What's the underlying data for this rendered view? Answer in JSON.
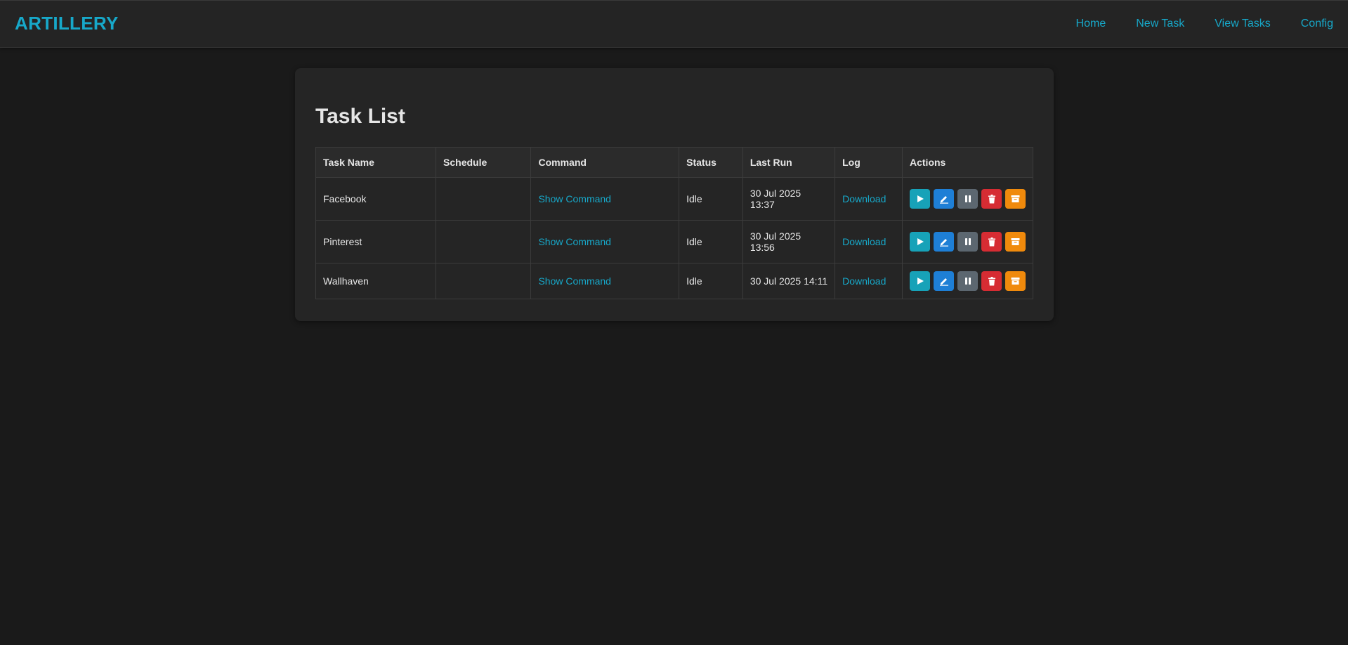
{
  "brand": "ARTILLERY",
  "nav": {
    "home": "Home",
    "new_task": "New Task",
    "view_tasks": "View Tasks",
    "config": "Config"
  },
  "page": {
    "title": "Task List"
  },
  "table": {
    "headers": [
      "Task Name",
      "Schedule",
      "Command",
      "Status",
      "Last Run",
      "Log",
      "Actions"
    ],
    "rows": [
      {
        "name": "Facebook",
        "schedule": "",
        "command": "Show Command",
        "status": "Idle",
        "last_run_date": "30 Jul 2025",
        "last_run_time": "13:37",
        "log": "Download"
      },
      {
        "name": "Pinterest",
        "schedule": "",
        "command": "Show Command",
        "status": "Idle",
        "last_run_date": "30 Jul 2025",
        "last_run_time": "13:56",
        "log": "Download"
      },
      {
        "name": "Wallhaven",
        "schedule": "",
        "command": "Show Command",
        "status": "Idle",
        "last_run_date": "30 Jul 2025",
        "last_run_time": "14:11",
        "log": "Download"
      }
    ]
  },
  "action_icons": [
    "play-icon",
    "edit-icon",
    "pause-icon",
    "trash-icon",
    "archive-icon"
  ],
  "colors": {
    "accent": "#17a8c9",
    "run": "#17a2b8",
    "edit": "#1e7fd6",
    "pause": "#5c6770",
    "delete": "#d62c33",
    "archive": "#f08a0c"
  }
}
